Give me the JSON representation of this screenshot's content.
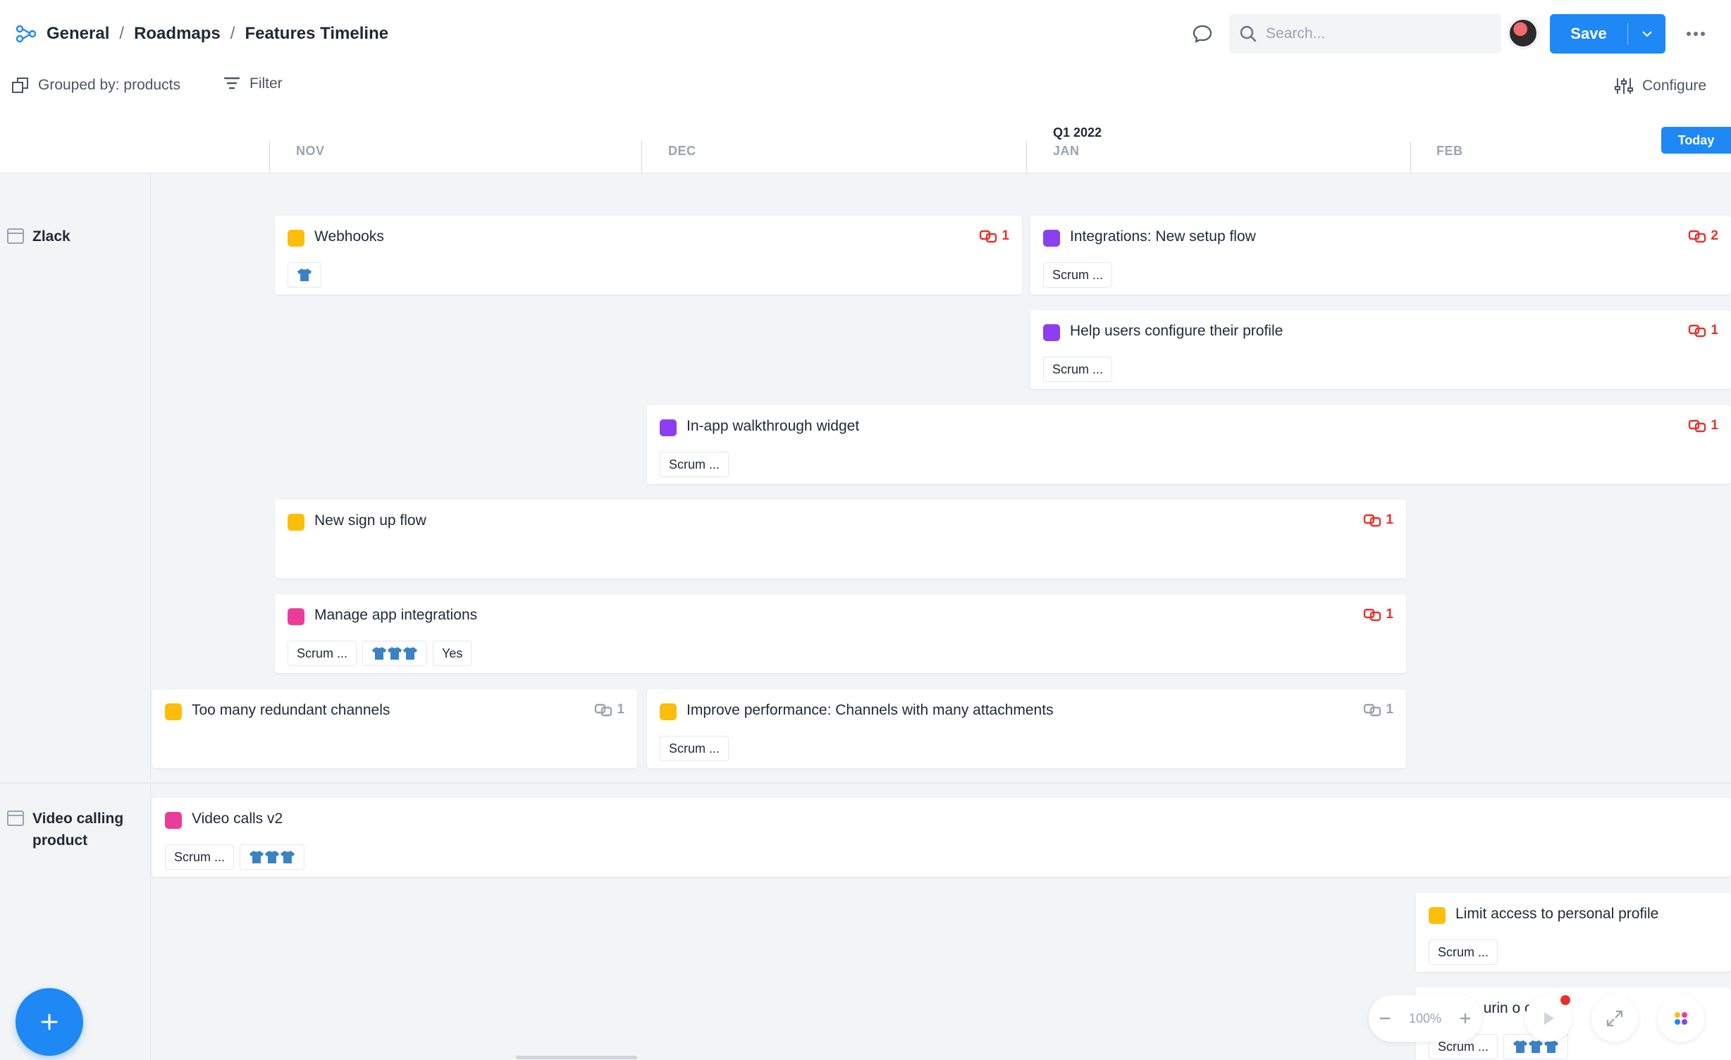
{
  "header": {
    "breadcrumb": [
      "General",
      "Roadmaps",
      "Features Timeline"
    ],
    "search_placeholder": "Search...",
    "save_label": "Save",
    "brand_color": "#1e88f5"
  },
  "toolbar": {
    "grouped_label": "Grouped by: products",
    "filter_label": "Filter",
    "configure_label": "Configure"
  },
  "timeline": {
    "quarter": "Q1 2022",
    "months": [
      "NOV",
      "DEC",
      "JAN",
      "FEB"
    ],
    "today_label": "Today"
  },
  "lanes": [
    {
      "name": "Zlack"
    },
    {
      "name_line1": "Video calling",
      "name_line2": "product"
    }
  ],
  "colors": {
    "yellow": "#fbbf0b",
    "purple": "#8b3ff0",
    "pink": "#ec3c9b",
    "link_red": "#e5322d"
  },
  "cards": {
    "webhooks": {
      "title": "Webhooks",
      "links": "1",
      "tag_icon": "shirt-icon"
    },
    "integrations": {
      "title": "Integrations: New setup flow",
      "links": "2",
      "tag": "Scrum ..."
    },
    "help_users": {
      "title": "Help users configure their profile",
      "links": "1",
      "tag": "Scrum ..."
    },
    "walkthrough": {
      "title": "In-app walkthrough widget",
      "links": "1",
      "tag": "Scrum ..."
    },
    "signup": {
      "title": "New sign up flow",
      "links": "1"
    },
    "manage_apps": {
      "title": "Manage app integrations",
      "links": "1",
      "tag": "Scrum ...",
      "tag3": "Yes"
    },
    "redundant": {
      "title": "Too many redundant channels",
      "links": "1"
    },
    "performance": {
      "title": "Improve performance: Channels with many attachments",
      "links": "1",
      "tag": "Scrum ..."
    },
    "video_calls": {
      "title": "Video calls v2",
      "tag": "Scrum ..."
    },
    "limit_access": {
      "title": "Limit access to personal profile",
      "tag": "Scrum ..."
    },
    "partial": {
      "title": "sha  urin  o c",
      "tag": "Scrum ..."
    }
  },
  "zoom": {
    "level": "100%"
  }
}
